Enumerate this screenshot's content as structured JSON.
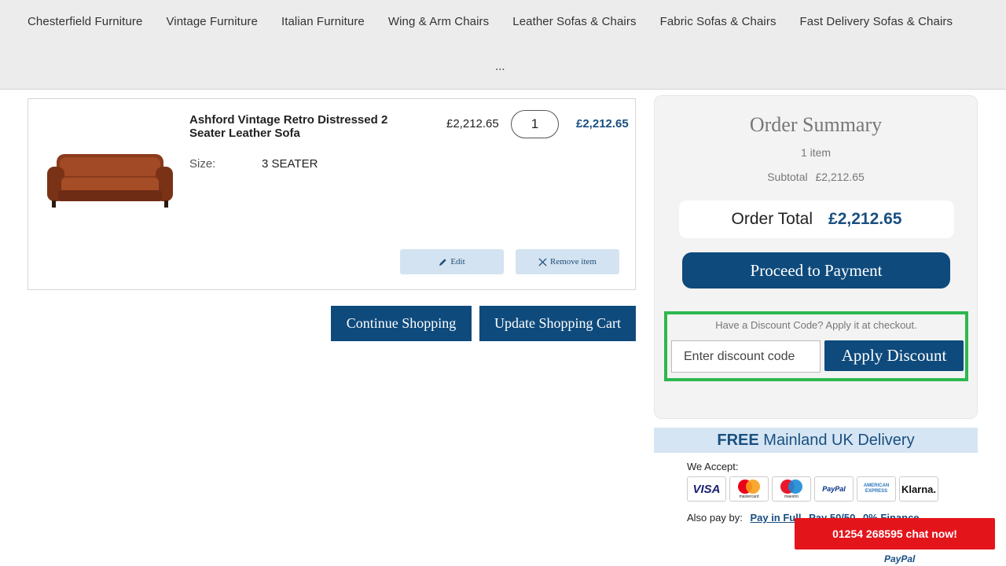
{
  "nav": {
    "items": [
      "Chesterfield Furniture",
      "Vintage Furniture",
      "Italian Furniture",
      "Wing & Arm Chairs",
      "Leather Sofas & Chairs",
      "Fabric Sofas & Chairs",
      "Fast Delivery Sofas & Chairs"
    ],
    "more": "..."
  },
  "cart": {
    "item": {
      "name": "Ashford Vintage Retro Distressed 2 Seater Leather Sofa",
      "size_label": "Size:",
      "size_value": "3 SEATER",
      "unit_price": "£2,212.65",
      "quantity": "1",
      "line_total": "£2,212.65",
      "edit_label": "Edit",
      "remove_label": "Remove item"
    },
    "continue_label": "Continue Shopping",
    "update_label": "Update Shopping Cart"
  },
  "summary": {
    "title": "Order Summary",
    "items_count": "1 item",
    "subtotal_label": "Subtotal",
    "subtotal_value": "£2,212.65",
    "total_label": "Order Total",
    "total_value": "£2,212.65",
    "pay_label": "Proceed to Payment",
    "discount_hint": "Have a Discount Code? Apply it at checkout.",
    "discount_placeholder": "Enter discount code",
    "discount_button": "Apply Discount"
  },
  "delivery": {
    "free": "FREE",
    "rest": "Mainland UK Delivery"
  },
  "payments": {
    "accept_label": "We Accept:",
    "cards": [
      "VISA",
      "mastercard",
      "maestro",
      "PayPal",
      "AMERICAN EXPRESS",
      "Klarna."
    ],
    "also_label": "Also pay by:",
    "options": [
      "Pay in Full",
      "Pay 50/50",
      "0% Finance"
    ],
    "footer_logo": "PayPal"
  },
  "chat": {
    "label": "01254 268595 chat now!"
  },
  "colors": {
    "brand_blue": "#0e4a7c",
    "price_blue": "#1a4f80",
    "chat_red": "#e4141b",
    "highlight_green": "#2db84d"
  }
}
